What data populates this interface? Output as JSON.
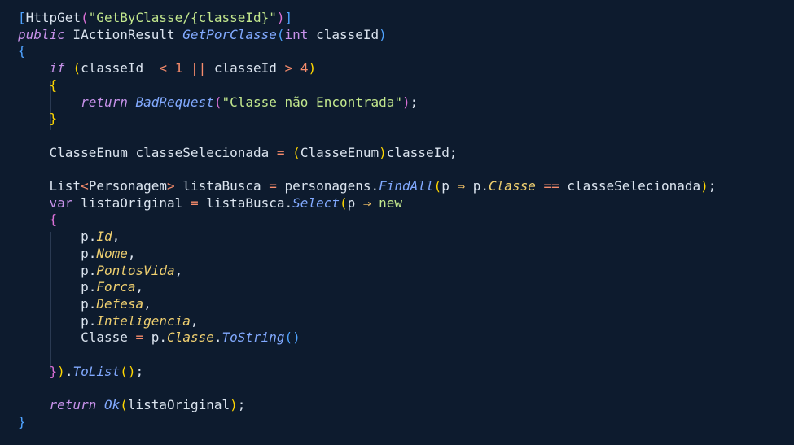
{
  "editor": {
    "lines": [
      [
        [
          "b3",
          "["
        ],
        [
          "plain",
          "HttpGet"
        ],
        [
          "b2",
          "("
        ],
        [
          "str",
          "\"GetByClasse/{classeId}\""
        ],
        [
          "b2",
          ")"
        ],
        [
          "b3",
          "]"
        ]
      ],
      [
        [
          "kw",
          "public"
        ],
        [
          "plain",
          " IActionResult "
        ],
        [
          "fn",
          "GetPorClasse"
        ],
        [
          "b3",
          "("
        ],
        [
          "kw2",
          "int"
        ],
        [
          "plain",
          " classeId"
        ],
        [
          "b3",
          ")"
        ]
      ],
      [
        [
          "b3",
          "{"
        ]
      ],
      [
        [
          "plain",
          "    "
        ],
        [
          "kw",
          "if"
        ],
        [
          "plain",
          " "
        ],
        [
          "b1",
          "("
        ],
        [
          "plain",
          "classeId  "
        ],
        [
          "op",
          "<"
        ],
        [
          "plain",
          " "
        ],
        [
          "num",
          "1"
        ],
        [
          "plain",
          " "
        ],
        [
          "op",
          "||"
        ],
        [
          "plain",
          " classeId "
        ],
        [
          "op",
          ">"
        ],
        [
          "plain",
          " "
        ],
        [
          "num",
          "4"
        ],
        [
          "b1",
          ")"
        ]
      ],
      [
        [
          "plain",
          "    "
        ],
        [
          "b1",
          "{"
        ]
      ],
      [
        [
          "plain",
          "        "
        ],
        [
          "kw",
          "return"
        ],
        [
          "plain",
          " "
        ],
        [
          "fn",
          "BadRequest"
        ],
        [
          "b2",
          "("
        ],
        [
          "str",
          "\"Classe não Encontrada\""
        ],
        [
          "b2",
          ")"
        ],
        [
          "plain",
          ";"
        ]
      ],
      [
        [
          "plain",
          "    "
        ],
        [
          "b1",
          "}"
        ]
      ],
      [
        [
          "plain",
          ""
        ]
      ],
      [
        [
          "plain",
          "    ClasseEnum classeSelecionada "
        ],
        [
          "op",
          "="
        ],
        [
          "plain",
          " "
        ],
        [
          "b1",
          "("
        ],
        [
          "plain",
          "ClasseEnum"
        ],
        [
          "b1",
          ")"
        ],
        [
          "plain",
          "classeId;"
        ]
      ],
      [
        [
          "plain",
          ""
        ]
      ],
      [
        [
          "plain",
          "    List"
        ],
        [
          "op",
          "<"
        ],
        [
          "plain",
          "Personagem"
        ],
        [
          "op",
          ">"
        ],
        [
          "plain",
          " listaBusca "
        ],
        [
          "op",
          "="
        ],
        [
          "plain",
          " personagens."
        ],
        [
          "fn",
          "FindAll"
        ],
        [
          "b1",
          "("
        ],
        [
          "plain",
          "p "
        ],
        [
          "arr",
          "⇒"
        ],
        [
          "plain",
          " p."
        ],
        [
          "prop",
          "Classe"
        ],
        [
          "plain",
          " "
        ],
        [
          "op",
          "=="
        ],
        [
          "plain",
          " classeSelecionada"
        ],
        [
          "b1",
          ")"
        ],
        [
          "plain",
          ";"
        ]
      ],
      [
        [
          "plain",
          "    "
        ],
        [
          "kw2",
          "var"
        ],
        [
          "plain",
          " listaOriginal "
        ],
        [
          "op",
          "="
        ],
        [
          "plain",
          " listaBusca."
        ],
        [
          "fn",
          "Select"
        ],
        [
          "b1",
          "("
        ],
        [
          "plain",
          "p "
        ],
        [
          "arr",
          "⇒"
        ],
        [
          "plain",
          " "
        ],
        [
          "new",
          "new"
        ]
      ],
      [
        [
          "plain",
          "    "
        ],
        [
          "b2",
          "{"
        ]
      ],
      [
        [
          "plain",
          "        p."
        ],
        [
          "prop",
          "Id"
        ],
        [
          "plain",
          ","
        ]
      ],
      [
        [
          "plain",
          "        p."
        ],
        [
          "prop",
          "Nome"
        ],
        [
          "plain",
          ","
        ]
      ],
      [
        [
          "plain",
          "        p."
        ],
        [
          "prop",
          "PontosVida"
        ],
        [
          "plain",
          ","
        ]
      ],
      [
        [
          "plain",
          "        p."
        ],
        [
          "prop",
          "Forca"
        ],
        [
          "plain",
          ","
        ]
      ],
      [
        [
          "plain",
          "        p."
        ],
        [
          "prop",
          "Defesa"
        ],
        [
          "plain",
          ","
        ]
      ],
      [
        [
          "plain",
          "        p."
        ],
        [
          "prop",
          "Inteligencia"
        ],
        [
          "plain",
          ","
        ]
      ],
      [
        [
          "plain",
          "        Classe "
        ],
        [
          "op",
          "="
        ],
        [
          "plain",
          " p."
        ],
        [
          "prop",
          "Classe"
        ],
        [
          "plain",
          "."
        ],
        [
          "fn",
          "ToString"
        ],
        [
          "b3",
          "()"
        ]
      ],
      [
        [
          "plain",
          ""
        ]
      ],
      [
        [
          "plain",
          "    "
        ],
        [
          "b2",
          "}"
        ],
        [
          "b1",
          ")"
        ],
        [
          "plain",
          "."
        ],
        [
          "fn",
          "ToList"
        ],
        [
          "b1",
          "()"
        ],
        [
          "plain",
          ";"
        ]
      ],
      [
        [
          "plain",
          ""
        ]
      ],
      [
        [
          "plain",
          "    "
        ],
        [
          "kw",
          "return"
        ],
        [
          "plain",
          " "
        ],
        [
          "fn",
          "Ok"
        ],
        [
          "b1",
          "("
        ],
        [
          "plain",
          "listaOriginal"
        ],
        [
          "b1",
          ")"
        ],
        [
          "plain",
          ";"
        ]
      ],
      [
        [
          "b3",
          "}"
        ]
      ]
    ]
  }
}
